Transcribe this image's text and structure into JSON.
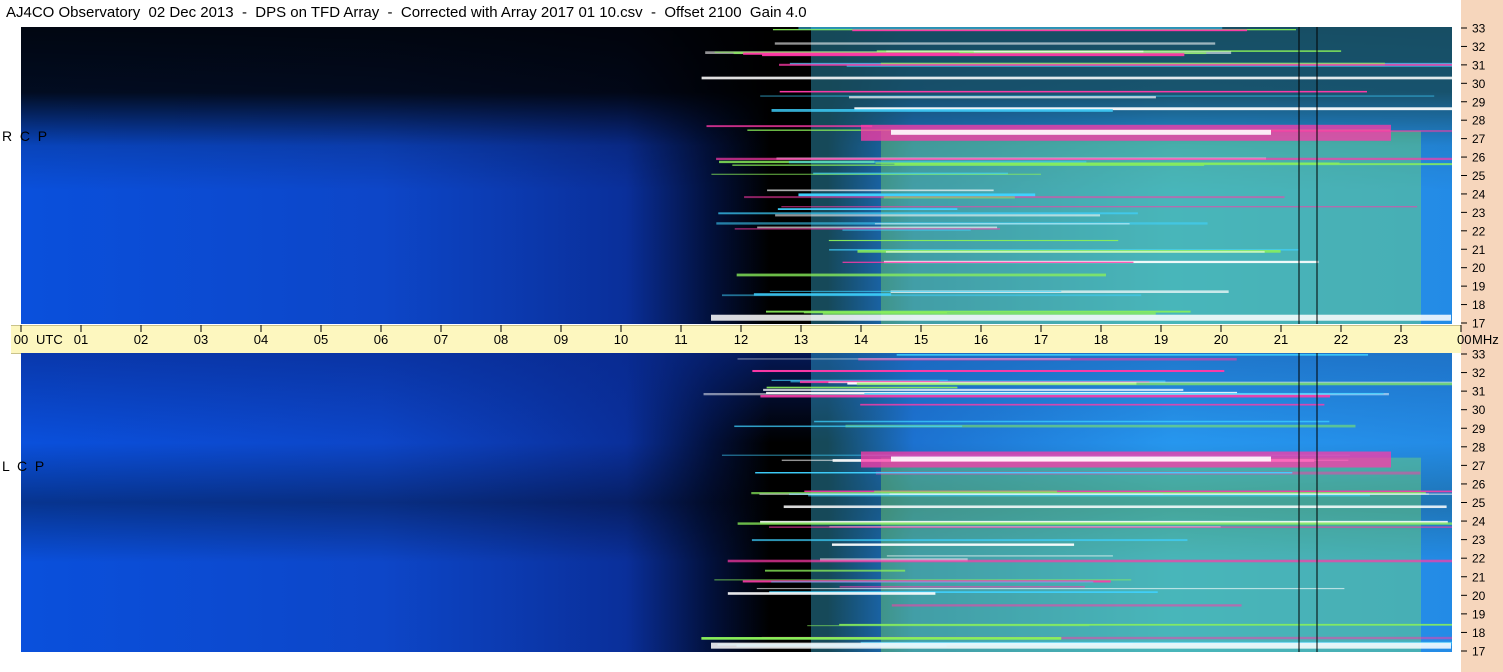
{
  "title": "AJ4CO Observatory  02 Dec 2013  -  DPS on TFD Array  -  Corrected with Array 2017 01 10.csv  -  Offset 2100  Gain 4.0",
  "chart_data": {
    "type": "heatmap",
    "x_ticks": [
      "00",
      "01",
      "02",
      "03",
      "04",
      "05",
      "06",
      "07",
      "08",
      "09",
      "10",
      "11",
      "12",
      "13",
      "14",
      "15",
      "16",
      "17",
      "18",
      "19",
      "20",
      "21",
      "22",
      "23",
      "00"
    ],
    "x_unit_label": "UTC",
    "y_unit_label": "MHz",
    "y_ticks": [
      "33",
      "32",
      "31",
      "30",
      "29",
      "28",
      "27",
      "26",
      "25",
      "24",
      "23",
      "22",
      "21",
      "20",
      "19",
      "18",
      "17"
    ],
    "xlim": [
      0,
      24
    ],
    "ylim": [
      17,
      33
    ],
    "panels": [
      {
        "label": "R  C  P"
      },
      {
        "label": "L  C  P"
      }
    ],
    "colors": {
      "low": "#000000",
      "mid": "#0a50dc",
      "high_cyan": "#3fd2ff",
      "high_green": "#8af05a",
      "peak_pink": "#ff3aa8",
      "saturated": "#ffffff"
    }
  }
}
